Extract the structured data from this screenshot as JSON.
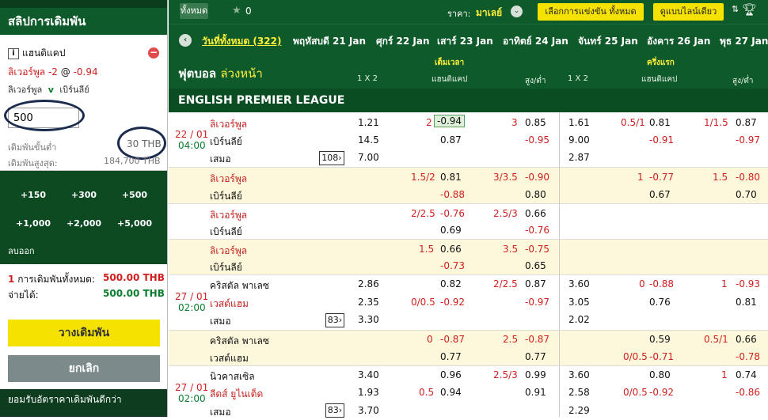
{
  "slip": {
    "title": "สลิปการเดิมพัน",
    "bet_type": "แฮนดิแคป",
    "selection_team": "ลิเวอร์พูล",
    "selection_hdp": "-2",
    "selection_at": "@",
    "selection_odds": "-0.94",
    "match_home": "ลิเวอร์พูล",
    "match_v": "v",
    "match_away": "เบิร์นลีย์",
    "stake": "500",
    "min_label": "เดิมพันขั้นต่ำ",
    "min_value": "30 THB",
    "max_label": "เดิมพันสูงสุด:",
    "max_value": "184,700 THB",
    "quick_amounts": [
      "+150",
      "+300",
      "+500",
      "+1,000",
      "+2,000",
      "+5,000"
    ],
    "clear_label": "ลบออก",
    "total_count": "1",
    "total_label": "การเดิมพันทั้งหมด:",
    "total_value": "500.00",
    "total_currency": "THB",
    "win_label": "จ่ายได้:",
    "win_value": "500.00",
    "win_currency": "THB",
    "place_label": "วางเดิมพัน",
    "cancel_label": "ยกเลิก",
    "accept_label": "ยอมรับอัตราคาเดิมพันดีกว่า"
  },
  "header": {
    "all_tab": "ทั้งหมด",
    "star_count": "0",
    "price_label": "ราคา:",
    "price_value": "มาเลย์",
    "select_comp": "เลือกการแข่งขัน",
    "select_comp_value": "ทั้งหมด",
    "view_mode": "ดูแบบไลน์เดียว"
  },
  "days": {
    "all": "วันที่ทั้งหมด (322)",
    "list": [
      "พฤหัสบดี 21 Jan",
      "ศุกร์ 22 Jan",
      "เสาร์ 23 Jan",
      "อาทิตย์ 24 Jan",
      "จันทร์ 25 Jan",
      "อังคาร 26 Jan",
      "พุธ 27 Jan"
    ]
  },
  "columns": {
    "title_main": "ฟุตบอล",
    "title_sub": "ล่วงหน้า",
    "full_time": "เต็มเวลา",
    "first_half": "ครึ่งแรก",
    "x12": "1 X 2",
    "handicap": "แฮนดิแคป",
    "over_under": "สูง/ต่ำ"
  },
  "league": "ENGLISH PREMIER LEAGUE",
  "matches": [
    {
      "date": "22 / 01",
      "time": "04:00",
      "more": "108",
      "home": "ลิเวอร์พูล",
      "away": "เบิร์นลีย์",
      "draw": "เสมอ",
      "lines": [
        {
          "home": "ลิเวอร์พูล",
          "away": "เบิร์นลีย์",
          "x1": "1.21",
          "x2": "14.5",
          "xd": "7.00",
          "hdp": "2",
          "hdp_h": "-0.94",
          "hdp_a": "0.87",
          "ou": "3",
          "ou_o": "0.85",
          "ou_u": "-0.95",
          "h1x1": "1.61",
          "h1x2": "9.00",
          "h1xd": "2.87",
          "h1hdp": "0.5/1",
          "h1hdp_h": "0.81",
          "h1hdp_a": "-0.91",
          "h1ou": "1/1.5",
          "h1ou_o": "0.87",
          "h1ou_u": "-0.97"
        },
        {
          "home": "ลิเวอร์พูล",
          "away": "เบิร์นลีย์",
          "hdp": "1.5/2",
          "hdp_h": "0.81",
          "hdp_a": "-0.88",
          "ou": "3/3.5",
          "ou_o": "-0.90",
          "ou_u": "0.80",
          "h1hdp": "1",
          "h1hdp_h": "-0.77",
          "h1hdp_a": "0.67",
          "h1ou": "1.5",
          "h1ou_o": "-0.80",
          "h1ou_u": "0.70"
        },
        {
          "home": "ลิเวอร์พูล",
          "away": "เบิร์นลีย์",
          "hdp": "2/2.5",
          "hdp_h": "-0.76",
          "hdp_a": "0.69",
          "ou": "2.5/3",
          "ou_o": "0.66",
          "ou_u": "-0.76"
        },
        {
          "home": "ลิเวอร์พูล",
          "away": "เบิร์นลีย์",
          "hdp": "1.5",
          "hdp_h": "0.66",
          "hdp_a": "-0.73",
          "ou": "3.5",
          "ou_o": "-0.75",
          "ou_u": "0.65"
        }
      ]
    },
    {
      "date": "27 / 01",
      "time": "02:00",
      "more": "83",
      "home": "คริสตัล พาเลซ",
      "away": "เวสต์แฮม",
      "draw": "เสมอ",
      "lines": [
        {
          "home": "คริสตัล พาเลซ",
          "away": "เวสต์แฮม",
          "x1": "2.86",
          "x2": "2.35",
          "xd": "3.30",
          "hdp": "0/0.5",
          "hdp_h": "0.82",
          "hdp_a": "-0.92",
          "ou": "2/2.5",
          "ou_o": "0.87",
          "ou_u": "-0.97",
          "h1x1": "3.60",
          "h1x2": "3.05",
          "h1xd": "2.02",
          "h1hdp": "0",
          "h1hdp_h": "-0.88",
          "h1hdp_a": "0.76",
          "h1ou": "1",
          "h1ou_o": "-0.93",
          "h1ou_u": "0.81"
        },
        {
          "home": "คริสตัล พาเลซ",
          "away": "เวสต์แฮม",
          "hdp": "0",
          "hdp_h": "-0.87",
          "hdp_a": "0.77",
          "ou": "2.5",
          "ou_o": "-0.87",
          "ou_u": "0.77",
          "h1hdp": "0/0.5",
          "h1hdp_h": "0.59",
          "h1hdp_a": "-0.71",
          "h1ou": "0.5/1",
          "h1ou_o": "0.66",
          "h1ou_u": "-0.78"
        }
      ]
    },
    {
      "date": "27 / 01",
      "time": "02:00",
      "more": "83",
      "home": "นิวคาสเซิล",
      "away": "ลีดส์ ยูไนเต็ด",
      "draw": "เสมอ",
      "lines": [
        {
          "home": "นิวคาสเซิล",
          "away": "ลีดส์ ยูไนเต็ด",
          "x1": "3.40",
          "x2": "1.93",
          "xd": "3.70",
          "hdp": "0.5",
          "hdp_h": "0.96",
          "hdp_a": "0.94",
          "ou": "2.5/3",
          "ou_o": "0.99",
          "ou_u": "0.91",
          "h1x1": "3.60",
          "h1x2": "2.58",
          "h1xd": "2.29",
          "h1hdp": "0/0.5",
          "h1hdp_h": "0.80",
          "h1hdp_a": "-0.92",
          "h1ou": "1",
          "h1ou_o": "0.74",
          "h1ou_u": "-0.86"
        }
      ]
    }
  ],
  "colors": {
    "brand_green": "#0f5a2a",
    "accent_yellow": "#f6e200",
    "negative_red": "#d0201f",
    "alt_row": "#fdf8dc"
  }
}
